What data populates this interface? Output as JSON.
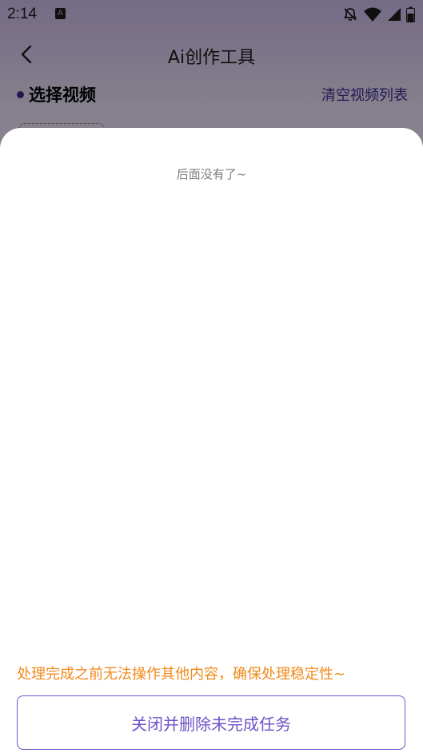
{
  "status_bar": {
    "time": "2:14",
    "notification_icon": "a-letter-icon",
    "icons": [
      "bell-off-icon",
      "wifi-icon",
      "signal-icon",
      "battery-icon"
    ]
  },
  "header": {
    "back_icon": "chevron-left-icon",
    "title": "Ai创作工具"
  },
  "section": {
    "title": "选择视频",
    "clear_label": "清空视频列表"
  },
  "sheet": {
    "end_of_list": "后面没有了~",
    "warning": "处理完成之前无法操作其他内容，确保处理稳定性~",
    "close_button_label": "关闭并删除未完成任务"
  },
  "colors": {
    "accent": "#6e52c8",
    "section_accent": "#3b2c8d",
    "warning": "#f08a1c",
    "muted_text": "#7c7c7c"
  }
}
